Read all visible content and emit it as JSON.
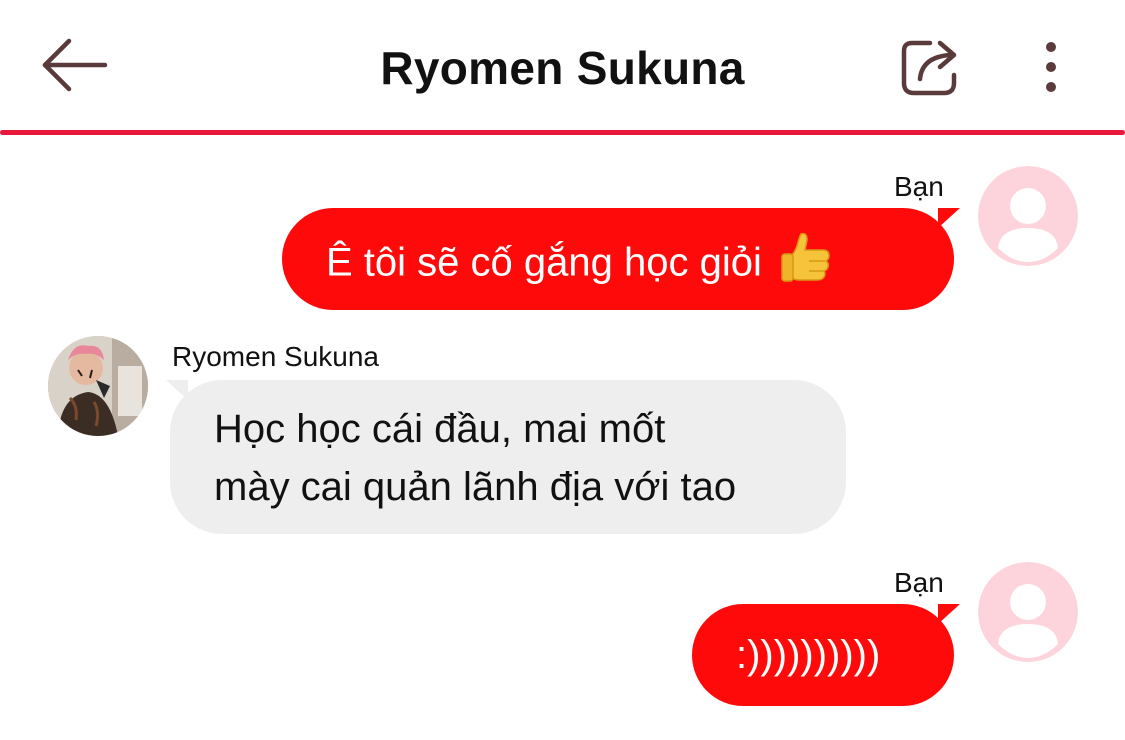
{
  "header": {
    "title": "Ryomen Sukuna",
    "back_icon": "arrow-left-icon",
    "share_icon": "share-icon",
    "more_icon": "more-vertical-icon",
    "accent_color": "#e8193c",
    "icon_color": "#5a3a3a"
  },
  "messages": [
    {
      "sender": "Bạn",
      "direction": "outgoing",
      "text": "Ê tôi sẽ cố gắng học giỏi",
      "emoji": "thumbs-up-emoji",
      "avatar": "default-user-avatar"
    },
    {
      "sender": "Ryomen Sukuna",
      "direction": "incoming",
      "lines": [
        "Học học cái đầu, mai mốt",
        "mày cai quản lãnh địa với tao"
      ],
      "avatar": "sukuna-photo-avatar"
    },
    {
      "sender": "Bạn",
      "direction": "outgoing",
      "text": ":))))))))))",
      "avatar": "default-user-avatar"
    }
  ],
  "colors": {
    "outgoing_bubble": "#ff0a0a",
    "incoming_bubble": "#eeeeee",
    "default_avatar_bg": "#fdd4dc"
  }
}
